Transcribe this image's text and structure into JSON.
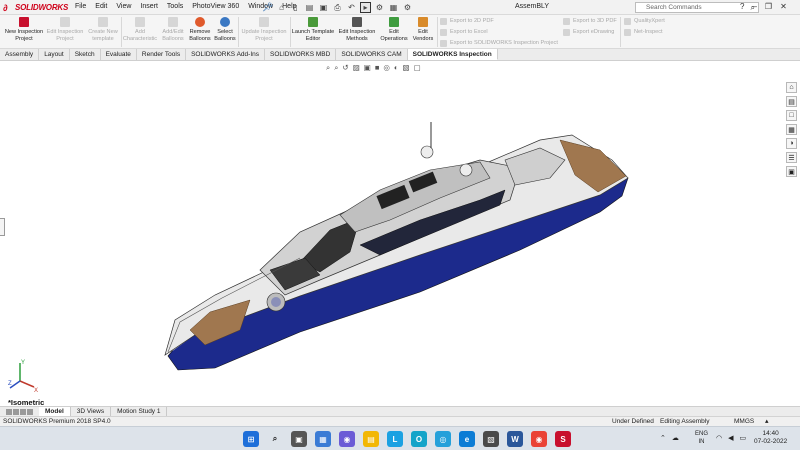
{
  "app": {
    "brand": "SOLIDWORKS",
    "document_title": "AssemBLY"
  },
  "menu": [
    "File",
    "Edit",
    "View",
    "Insert",
    "Tools",
    "PhotoView 360",
    "Window",
    "Help"
  ],
  "search": {
    "placeholder": "Search Commands"
  },
  "ribbon": {
    "buttons": [
      {
        "label": "New Inspection Project",
        "enabled": true
      },
      {
        "label": "Edit Inspection Project",
        "enabled": false
      },
      {
        "label": "Create New template",
        "enabled": false
      },
      {
        "label": "Add Characteristic",
        "enabled": false
      },
      {
        "label": "Add/Edit Balloons",
        "enabled": false
      },
      {
        "label": "Remove Balloons",
        "enabled": true
      },
      {
        "label": "Select Balloons",
        "enabled": true
      },
      {
        "label": "Update Inspection Project",
        "enabled": false
      },
      {
        "label": "Launch Template Editor",
        "enabled": true
      },
      {
        "label": "Edit Inspection Methods",
        "enabled": true
      },
      {
        "label": "Edit Operations",
        "enabled": true
      },
      {
        "label": "Edit Vendors",
        "enabled": true
      }
    ],
    "export_left": [
      "Export to 2D PDF",
      "Export to Excel",
      "Export to SOLIDWORKS Inspection Project"
    ],
    "export_right": [
      "Export to 3D PDF",
      "Export eDrawing"
    ],
    "quality": [
      "QualityXpert",
      "Net-Inspect"
    ]
  },
  "tabs": [
    {
      "label": "Assembly",
      "active": false
    },
    {
      "label": "Layout",
      "active": false
    },
    {
      "label": "Sketch",
      "active": false
    },
    {
      "label": "Evaluate",
      "active": false
    },
    {
      "label": "Render Tools",
      "active": false
    },
    {
      "label": "SOLIDWORKS Add-Ins",
      "active": false
    },
    {
      "label": "SOLIDWORKS MBD",
      "active": false
    },
    {
      "label": "SOLIDWORKS CAM",
      "active": false
    },
    {
      "label": "SOLIDWORKS Inspection",
      "active": true
    }
  ],
  "view": {
    "orientation_label": "*Isometric",
    "triad_axes": [
      "Y",
      "X",
      "Z"
    ]
  },
  "model_tabs": [
    {
      "label": "Model",
      "active": true
    },
    {
      "label": "3D Views",
      "active": false
    },
    {
      "label": "Motion Study 1",
      "active": false
    }
  ],
  "status": {
    "version": "SOLIDWORKS Premium 2018 SP4.0",
    "definition": "Under Defined",
    "mode": "Editing Assembly",
    "units": "MMGS"
  },
  "taskbar": {
    "lang_line1": "ENG",
    "lang_line2": "IN",
    "time": "14:40",
    "date": "07-02-2022"
  },
  "colors": {
    "brand_red": "#d0021b",
    "hull_blue": "#1c2a8c",
    "deck_teak": "#a0774f"
  }
}
